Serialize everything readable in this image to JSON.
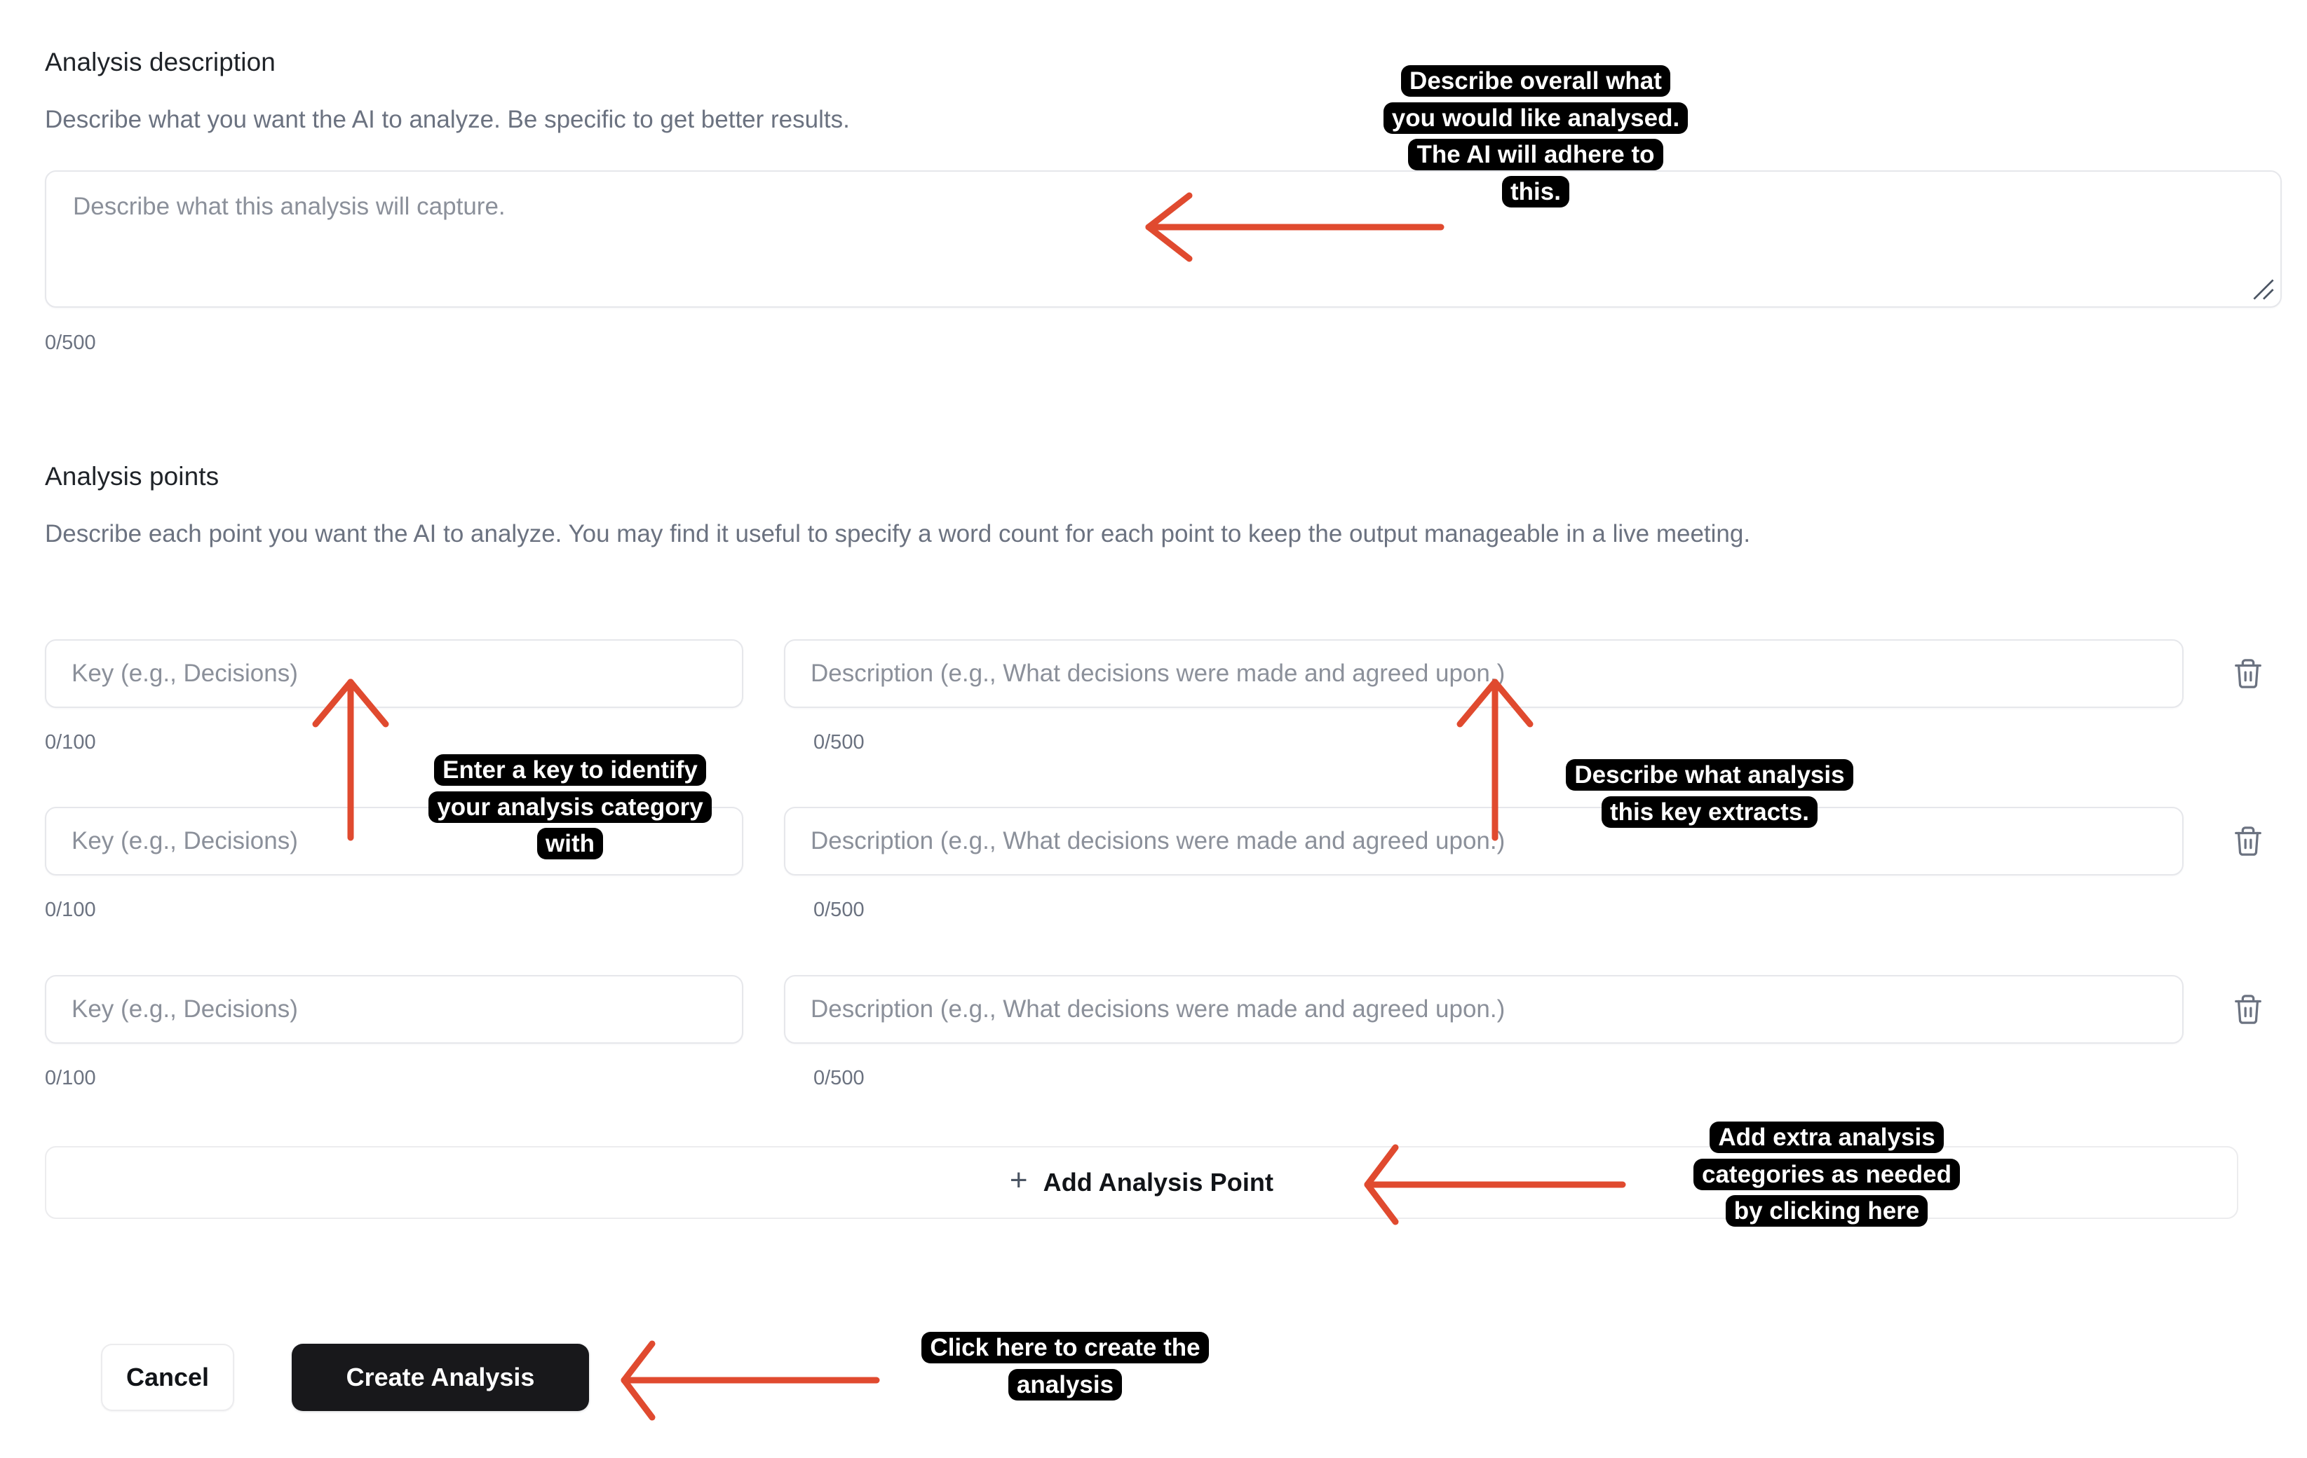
{
  "form": {
    "description_section": {
      "title": "Analysis description",
      "help": "Describe what you want the AI to analyze. Be specific to get better results.",
      "textarea_placeholder": "Describe what this analysis will capture.",
      "textarea_value": "",
      "counter": "0/500"
    },
    "points_section": {
      "title": "Analysis points",
      "help": "Describe each point you want the AI to analyze. You may find it useful to specify a word count for each point to keep the output manageable in a live meeting.",
      "rows": [
        {
          "key_placeholder": "Key (e.g., Decisions)",
          "key_value": "",
          "key_counter": "0/100",
          "desc_placeholder": "Description (e.g., What decisions were made and agreed upon.)",
          "desc_value": "",
          "desc_counter": "0/500",
          "delete_icon": "trash-icon"
        },
        {
          "key_placeholder": "Key (e.g., Decisions)",
          "key_value": "",
          "key_counter": "0/100",
          "desc_placeholder": "Description (e.g., What decisions were made and agreed upon.)",
          "desc_value": "",
          "desc_counter": "0/500",
          "delete_icon": "trash-icon"
        },
        {
          "key_placeholder": "Key (e.g., Decisions)",
          "key_value": "",
          "key_counter": "0/100",
          "desc_placeholder": "Description (e.g., What decisions were made and agreed upon.)",
          "desc_value": "",
          "desc_counter": "0/500",
          "delete_icon": "trash-icon"
        }
      ],
      "add_point_plus": "+",
      "add_point_label": "Add Analysis Point"
    },
    "footer": {
      "cancel_label": "Cancel",
      "create_label": "Create Analysis"
    }
  },
  "annotations": {
    "accent_color": "#E04A2F",
    "callout_bg": "#000000",
    "callout_text": "#FFFFFF",
    "items": [
      {
        "id": "describe-overall",
        "lines": [
          "Describe overall what",
          "you would like analysed.",
          "The AI will adhere to",
          "this."
        ]
      },
      {
        "id": "enter-key",
        "lines": [
          "Enter a key to identify",
          "your analysis category",
          "with"
        ]
      },
      {
        "id": "describe-key-extracts",
        "lines": [
          "Describe what analysis",
          "this key extracts."
        ]
      },
      {
        "id": "add-extra",
        "lines": [
          "Add extra analysis",
          "categories as needed",
          "by clicking here"
        ]
      },
      {
        "id": "click-create",
        "lines": [
          "Click here to create the",
          "analysis"
        ]
      }
    ]
  }
}
